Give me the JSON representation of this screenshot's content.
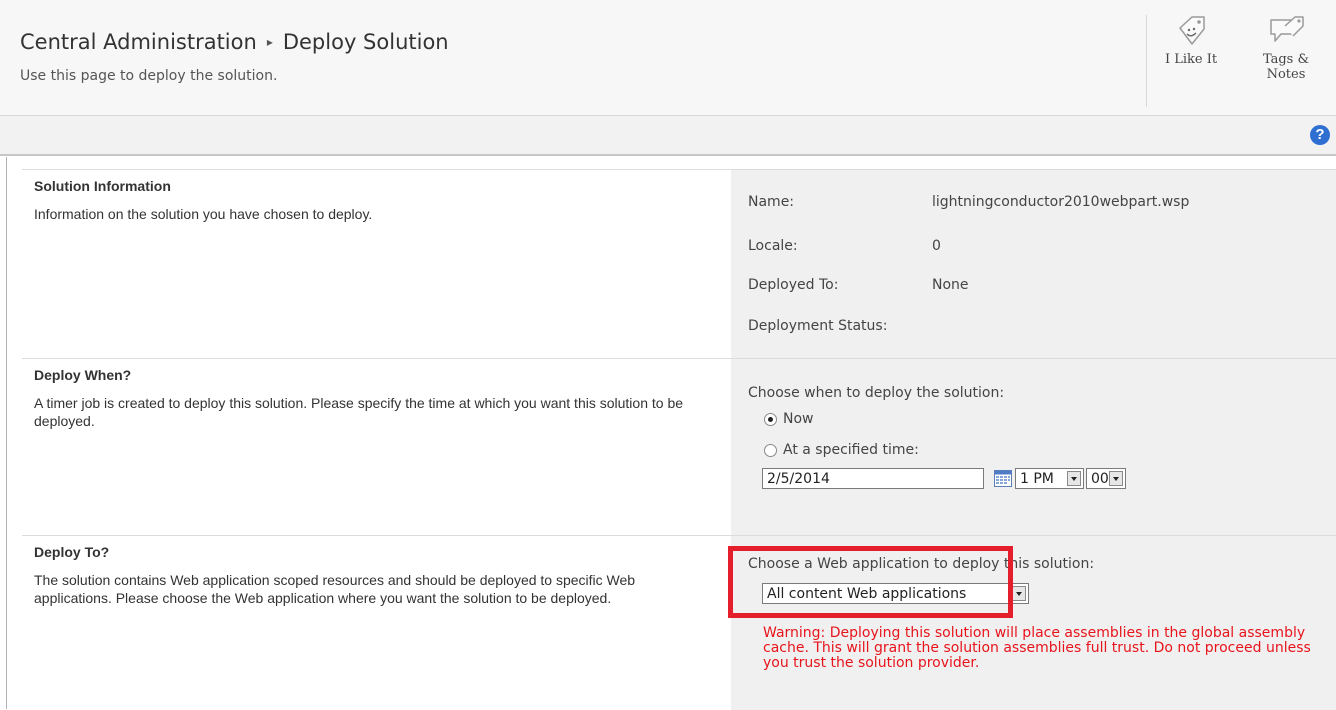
{
  "header": {
    "breadcrumb_root": "Central Administration",
    "breadcrumb_separator": "▸",
    "breadcrumb_current": "Deploy Solution",
    "subtitle": "Use this page to deploy the solution.",
    "i_like_it": "I Like It",
    "tags_notes_line1": "Tags &",
    "tags_notes_line2": "Notes"
  },
  "toolbar": {
    "help_glyph": "?"
  },
  "solution_information": {
    "title": "Solution Information",
    "description": "Information on the solution you have chosen to deploy.",
    "name_label": "Name:",
    "name_value": "lightningconductor2010webpart.wsp",
    "locale_label": "Locale:",
    "locale_value": "0",
    "deployed_to_label": "Deployed To:",
    "deployed_to_value": "None",
    "deployment_status_label": "Deployment Status:",
    "deployment_status_value": ""
  },
  "deploy_when": {
    "title": "Deploy When?",
    "description": "A timer job is created to deploy this solution. Please specify the time at which you want this solution to be deployed.",
    "prompt": "Choose when to deploy the solution:",
    "option_now": "Now",
    "option_specified": "At a specified time:",
    "selected": "now",
    "date_value": "2/5/2014",
    "hour_value": "1 PM",
    "minute_value": "00"
  },
  "deploy_to": {
    "title": "Deploy To?",
    "description": "The solution contains Web application scoped resources and should be deployed to specific Web applications. Please choose the Web application where you want the solution to be deployed.",
    "prompt": "Choose a Web application to deploy this solution:",
    "web_app_value": "All content Web applications",
    "warning": "Warning: Deploying this solution will place assemblies in the global assembly cache. This will grant the solution assemblies full trust. Do not proceed unless you trust the solution provider."
  },
  "colors": {
    "highlight": "#e41e2b",
    "warning_text": "#e8141c",
    "help_blue": "#2f6fd1",
    "panel_gray": "#f0f0f0"
  },
  "icons": [
    "like-tag-icon",
    "tags-notes-icon",
    "help-icon",
    "calendar-icon",
    "dropdown-arrow-icon",
    "radio-icon"
  ]
}
